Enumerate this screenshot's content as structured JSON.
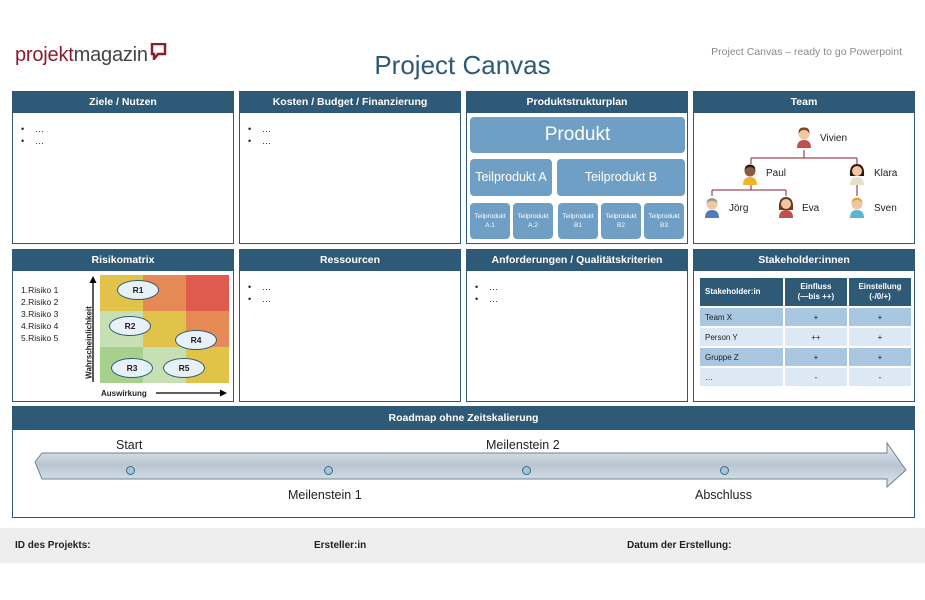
{
  "header": {
    "logo_part1": "projekt",
    "logo_part2": "magazin",
    "title": "Project Canvas",
    "subtitle": "Project Canvas – ready to go Powerpoint"
  },
  "panels": {
    "ziele": {
      "title": "Ziele / Nutzen",
      "bullets": [
        "…",
        "…"
      ]
    },
    "kosten": {
      "title": "Kosten / Budget / Finanzierung",
      "bullets": [
        "…",
        "…"
      ]
    },
    "psp": {
      "title": "Produktstrukturplan",
      "top": "Produkt",
      "mid": [
        "Teilprodukt A",
        "Teilprodukt B"
      ],
      "small": [
        [
          "Teilprodukt",
          "A.1"
        ],
        [
          "Teilprodukt",
          "A.2"
        ],
        [
          "Teilprodukt",
          "B1"
        ],
        [
          "Teilprodukt",
          "B2"
        ],
        [
          "Teilprodukt",
          "B3"
        ]
      ]
    },
    "team": {
      "title": "Team",
      "members": [
        "Vivien",
        "Paul",
        "Klara",
        "Jörg",
        "Eva",
        "Sven"
      ]
    },
    "risiko": {
      "title": "Risikomatrix",
      "list": [
        "1.Risiko 1",
        "2.Risiko 2",
        "3.Risiko 3",
        "4.Risiko 4",
        "5.Risiko 5"
      ],
      "risks": [
        "R1",
        "R2",
        "R3",
        "R4",
        "R5"
      ],
      "y_label": "Wahrscheinlichkeit",
      "x_label": "Auswirkung",
      "colors": {
        "green": "#a8d08d",
        "light_green": "#c6e0b4",
        "yellow": "#e2c34a",
        "orange": "#e58a55",
        "red": "#df5b4e"
      }
    },
    "ressourcen": {
      "title": "Ressourcen",
      "bullets": [
        "…",
        "…"
      ]
    },
    "anforderungen": {
      "title": "Anforderungen / Qualitätskriterien",
      "bullets": [
        "…",
        "…"
      ]
    },
    "stakeholder": {
      "title": "Stakeholder:innen",
      "headers": [
        "Stakeholder:in",
        "Einfluss",
        "(—bis ++)",
        "Einstellung",
        "(-/0/+)"
      ],
      "rows": [
        [
          "Team X",
          "+",
          "+"
        ],
        [
          "Person Y",
          "++",
          "+"
        ],
        [
          "Gruppe Z",
          "+",
          "+"
        ],
        [
          "…",
          "-",
          "-"
        ]
      ]
    }
  },
  "roadmap": {
    "title": "Roadmap ohne Zeitskalierung",
    "labels_top": [
      "Start",
      "Meilenstein 2"
    ],
    "labels_bottom": [
      "Meilenstein 1",
      "Abschluss"
    ]
  },
  "footer": {
    "id": "ID des Projekts:",
    "author": "Ersteller:in",
    "date": "Datum der Erstellung:"
  }
}
